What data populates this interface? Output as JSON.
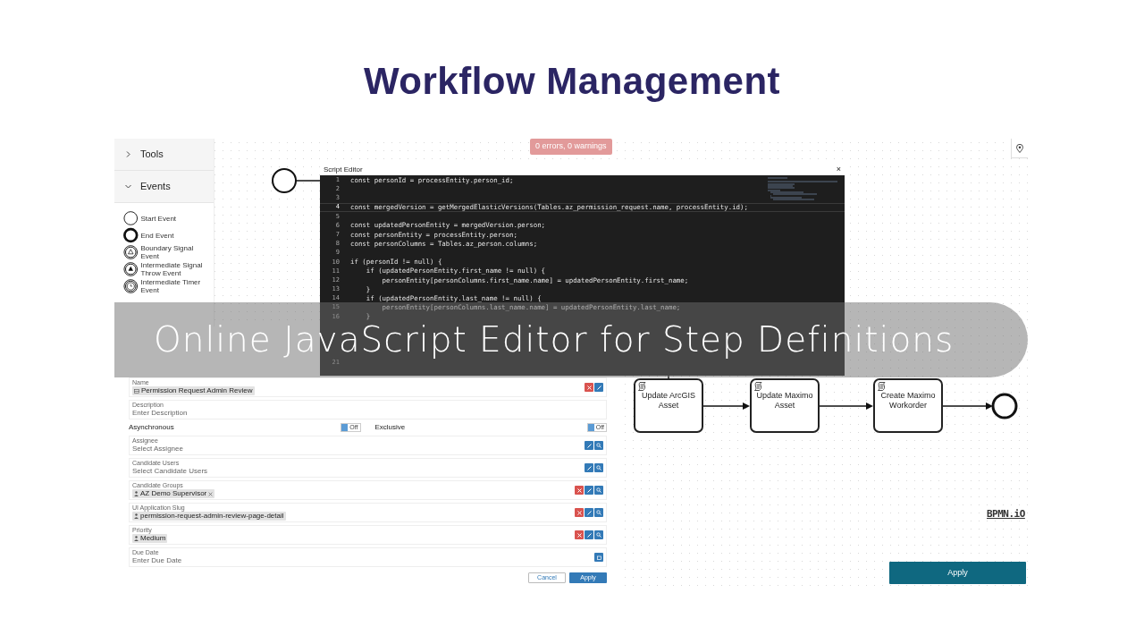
{
  "slide_title": "Workflow Management",
  "banner": "Online JavaScript Editor for Step Definitions",
  "sidebar": {
    "sections": [
      {
        "label": "Tools",
        "expanded": false
      },
      {
        "label": "Events",
        "expanded": true
      }
    ],
    "palette": [
      {
        "kind": "start",
        "label": "Start Event"
      },
      {
        "kind": "end",
        "label": "End Event"
      },
      {
        "kind": "boundary-signal",
        "label": "Boundary Signal Event"
      },
      {
        "kind": "signal-throw",
        "label": "Intermediate Signal Throw Event"
      },
      {
        "kind": "timer",
        "label": "Intermediate Timer Event"
      }
    ]
  },
  "status_badge": "0 errors, 0 warnings",
  "properties": {
    "fields": [
      {
        "kind": "tag",
        "label": "Name",
        "value": "Permission Request Admin Review"
      },
      {
        "kind": "input",
        "label": "Description",
        "placeholder": "Enter Description"
      },
      {
        "kind": "toggles",
        "items": [
          {
            "label": "Asynchronous",
            "on": false,
            "state": "Off"
          },
          {
            "label": "Exclusive",
            "on": false,
            "state": "Off"
          }
        ]
      },
      {
        "kind": "lookup",
        "label": "Assignee",
        "placeholder": "Select Assignee"
      },
      {
        "kind": "lookup",
        "label": "Candidate Users",
        "placeholder": "Select Candidate Users"
      },
      {
        "kind": "chip",
        "label": "Candidate Groups",
        "value": "AZ Demo Supervisor",
        "removable": true
      },
      {
        "kind": "chip",
        "label": "UI Application Slug",
        "value": "permission-request-admin-review-page-detail",
        "removable": false
      },
      {
        "kind": "chip",
        "label": "Priority",
        "value": "Medium",
        "removable": false
      },
      {
        "kind": "date",
        "label": "Due Date",
        "placeholder": "Enter Due Date"
      }
    ],
    "buttons": [
      {
        "label": "Cancel",
        "primary": false
      },
      {
        "label": "Apply",
        "primary": true
      }
    ]
  },
  "script_editor": {
    "title": "Script Editor",
    "close": "×",
    "lines": [
      {
        "number": "1",
        "code": "const personId = processEntity.person_id;",
        "current": false
      },
      {
        "number": "2",
        "current": false
      },
      {
        "number": "3",
        "current": false
      },
      {
        "number": "4",
        "code": "const mergedVersion = getMergedElasticVersions(Tables.az_permission_request.name, processEntity.id);",
        "current": true
      },
      {
        "number": "5",
        "current": false
      },
      {
        "number": "6",
        "code": "const updatedPersonEntity = mergedVersion.person;",
        "current": false
      },
      {
        "number": "7",
        "code": "const personEntity = processEntity.person;",
        "current": false
      },
      {
        "number": "8",
        "code": "const personColumns = Tables.az_person.columns;",
        "current": false
      },
      {
        "number": "9",
        "current": false
      },
      {
        "number": "10",
        "code": "if (personId != null) {",
        "current": false
      },
      {
        "number": "11",
        "code": "    if (updatedPersonEntity.first_name != null) {",
        "current": false
      },
      {
        "number": "12",
        "code": "        personEntity[personColumns.first_name.name] = updatedPersonEntity.first_name;",
        "current": false
      },
      {
        "number": "13",
        "code": "    }",
        "current": false
      },
      {
        "number": "14",
        "code": "    if (updatedPersonEntity.last_name != null) {",
        "current": false
      },
      {
        "number": "15",
        "code": "        personEntity[personColumns.last_name.name] = updatedPersonEntity.last_name;",
        "current": false
      },
      {
        "number": "16",
        "code": "    }",
        "current": false
      },
      {
        "number": "21",
        "current": false
      }
    ]
  },
  "diagram": {
    "tasks": [
      {
        "label": "Update ArcGIS Asset"
      },
      {
        "label": "Update Maximo Asset"
      },
      {
        "label": "Create Maximo Workorder"
      }
    ],
    "logo": "BPMN.iO"
  },
  "apply_button": "Apply"
}
